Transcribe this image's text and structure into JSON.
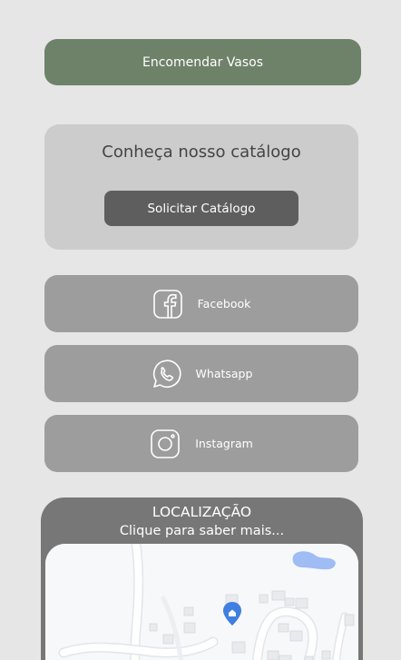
{
  "order": {
    "label": "Encomendar Vasos"
  },
  "catalog": {
    "title": "Conheça nosso catálogo",
    "button_label": "Solicitar Catálogo"
  },
  "social": [
    {
      "label": "Facebook",
      "icon": "facebook-icon"
    },
    {
      "label": "Whatsapp",
      "icon": "whatsapp-icon"
    },
    {
      "label": "Instagram",
      "icon": "instagram-icon"
    }
  ],
  "location": {
    "title": "LOCALIZAÇÃO",
    "subtitle": "Clique para saber mais...",
    "map": {
      "marker_icon": "map-pin-icon"
    }
  },
  "colors": {
    "background": "#e6e6e6",
    "accent_green": "#6e8169",
    "catalog_card": "#cccccc",
    "catalog_button": "#5e5e5e",
    "social_button": "#9d9d9d",
    "location_card": "#777777",
    "map_marker": "#3f7fe0",
    "map_water": "#9fbcf5"
  }
}
